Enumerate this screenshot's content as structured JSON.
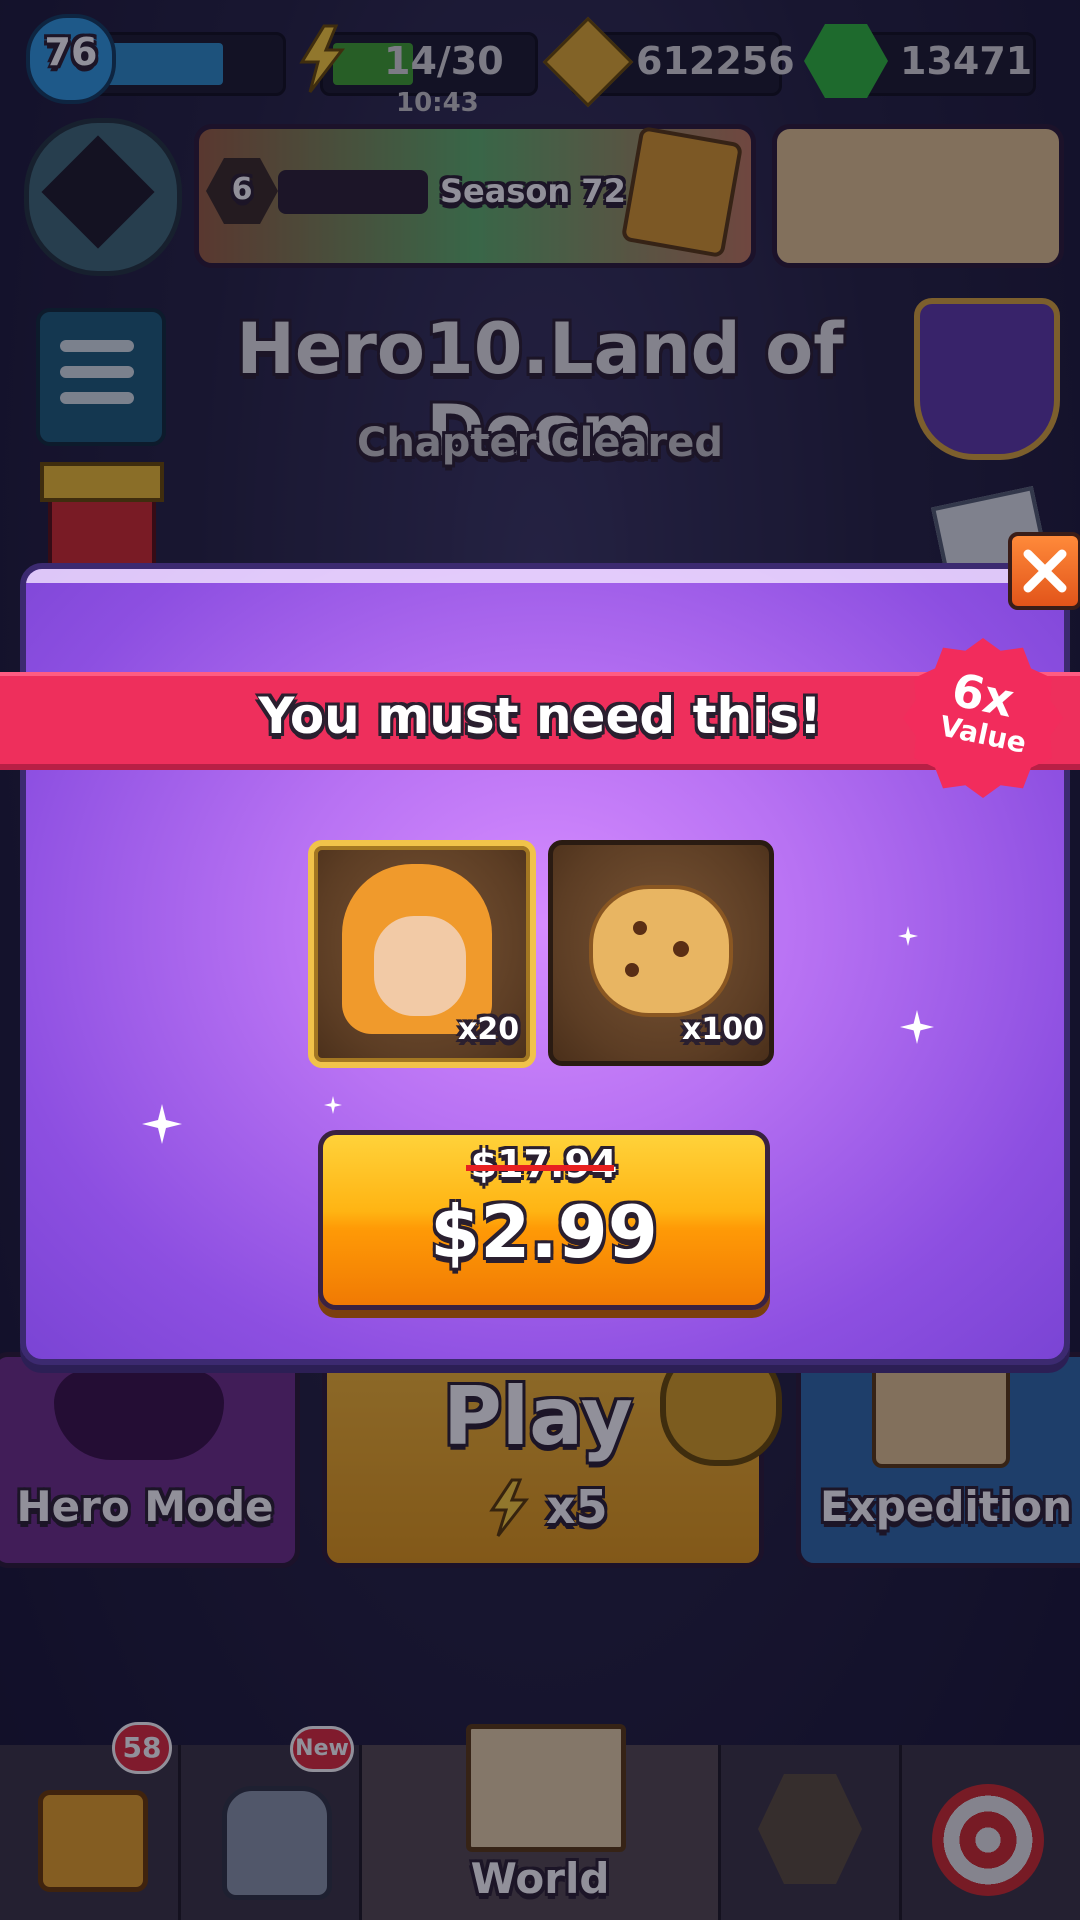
{
  "hud": {
    "level": "76",
    "energy": "14/30",
    "energy_timer": "10:43",
    "coins": "612256",
    "gems": "13471"
  },
  "season": {
    "level": "6",
    "label": "Season 72"
  },
  "chapter": {
    "title": "Hero10.Land of Doom",
    "status": "Chapter Cleared"
  },
  "offer": {
    "title": "You must need this!",
    "badge_multiplier": "6x",
    "badge_label": "Value",
    "items": [
      {
        "icon": "hero-shard-icon",
        "count": "x20"
      },
      {
        "icon": "cookie-icon",
        "count": "x100"
      }
    ],
    "old_price": "$17.94",
    "price": "$2.99"
  },
  "modes": {
    "hero_mode": "Hero Mode",
    "play": "Play",
    "play_cost": "x5",
    "expedition": "Expedition"
  },
  "nav": {
    "chest_badge": "58",
    "equipment_badge": "New",
    "world": "World"
  },
  "colors": {
    "modal": "#b872f3",
    "ribbon": "#ee2f5c",
    "button": "#ffb413",
    "close": "#ff8a3a"
  }
}
